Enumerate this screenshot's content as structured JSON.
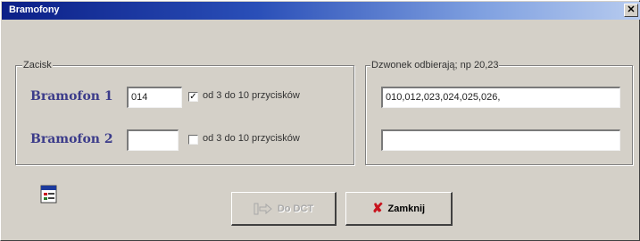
{
  "window": {
    "title": "Bramofony",
    "close_glyph": "✕"
  },
  "zacisk": {
    "group_title": "Zacisk",
    "rows": [
      {
        "label": "Bramofon 1",
        "value": "014",
        "checked": true,
        "check_glyph": "✓",
        "check_label": "od 3 do 10 przycisków"
      },
      {
        "label": "Bramofon 2",
        "value": "",
        "checked": false,
        "check_glyph": "",
        "check_label": "od 3 do 10 przycisków"
      }
    ]
  },
  "dzwonek": {
    "group_title": "Dzwonek odbierają; np 20,23",
    "fields": [
      "010,012,023,024,025,026,",
      ""
    ]
  },
  "buttons": {
    "do_dct_label": "Do DCT",
    "zamknij_label": "Zamknij",
    "zamknij_icon": "✘"
  },
  "icons": {
    "form_icon": "form-icon",
    "arrow_icon": "arrow-to-device-icon",
    "close_x_icon": "red-x-icon"
  },
  "colors": {
    "title_start": "#0b1f87",
    "title_end": "#b7cbef",
    "label_color": "#3b3b8a",
    "dialog_bg": "#d4d0c8",
    "close_red": "#c8141e"
  }
}
